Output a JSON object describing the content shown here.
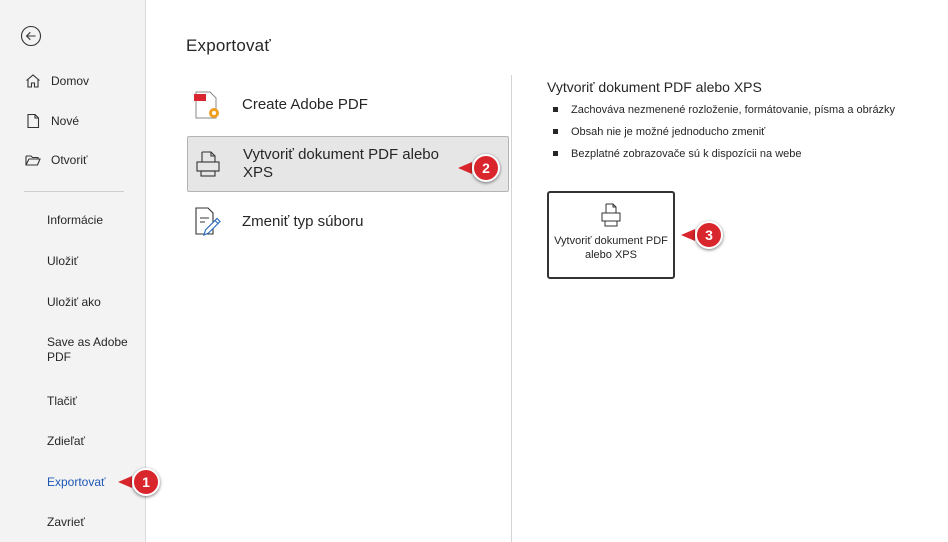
{
  "nav": {
    "top_items": [
      {
        "label": "Domov",
        "icon": "home-icon"
      },
      {
        "label": "Nové",
        "icon": "new-document-icon"
      },
      {
        "label": "Otvoriť",
        "icon": "folder-open-icon"
      }
    ],
    "items": [
      {
        "label": "Informácie"
      },
      {
        "label": "Uložiť"
      },
      {
        "label": "Uložiť ako"
      },
      {
        "label": "Save as Adobe PDF"
      },
      {
        "label": "Tlačiť"
      },
      {
        "label": "Zdieľať"
      },
      {
        "label": "Exportovať",
        "active": true
      },
      {
        "label": "Zavrieť"
      }
    ]
  },
  "page": {
    "title": "Exportovať"
  },
  "options": [
    {
      "label": "Create Adobe PDF",
      "icon": "adobe-pdf-icon"
    },
    {
      "label": "Vytvoriť dokument PDF alebo XPS",
      "icon": "pdf-xps-document-icon",
      "selected": true
    },
    {
      "label": "Zmeniť typ súboru",
      "icon": "change-file-type-icon"
    }
  ],
  "panel": {
    "title": "Vytvoriť dokument PDF alebo XPS",
    "bullets": [
      "Zachováva nezmenené rozloženie, formátovanie, písma a obrázky",
      "Obsah nie je možné jednoducho zmeniť",
      "Bezplatné zobrazovače sú k dispozícii na webe"
    ],
    "button_label": "Vytvoriť dokument PDF alebo XPS"
  },
  "callouts": [
    "1",
    "2",
    "3"
  ],
  "colors": {
    "active_nav": "#1e57b6",
    "callout": "#d9262c",
    "sidebar_bg": "#f3f3f3"
  }
}
